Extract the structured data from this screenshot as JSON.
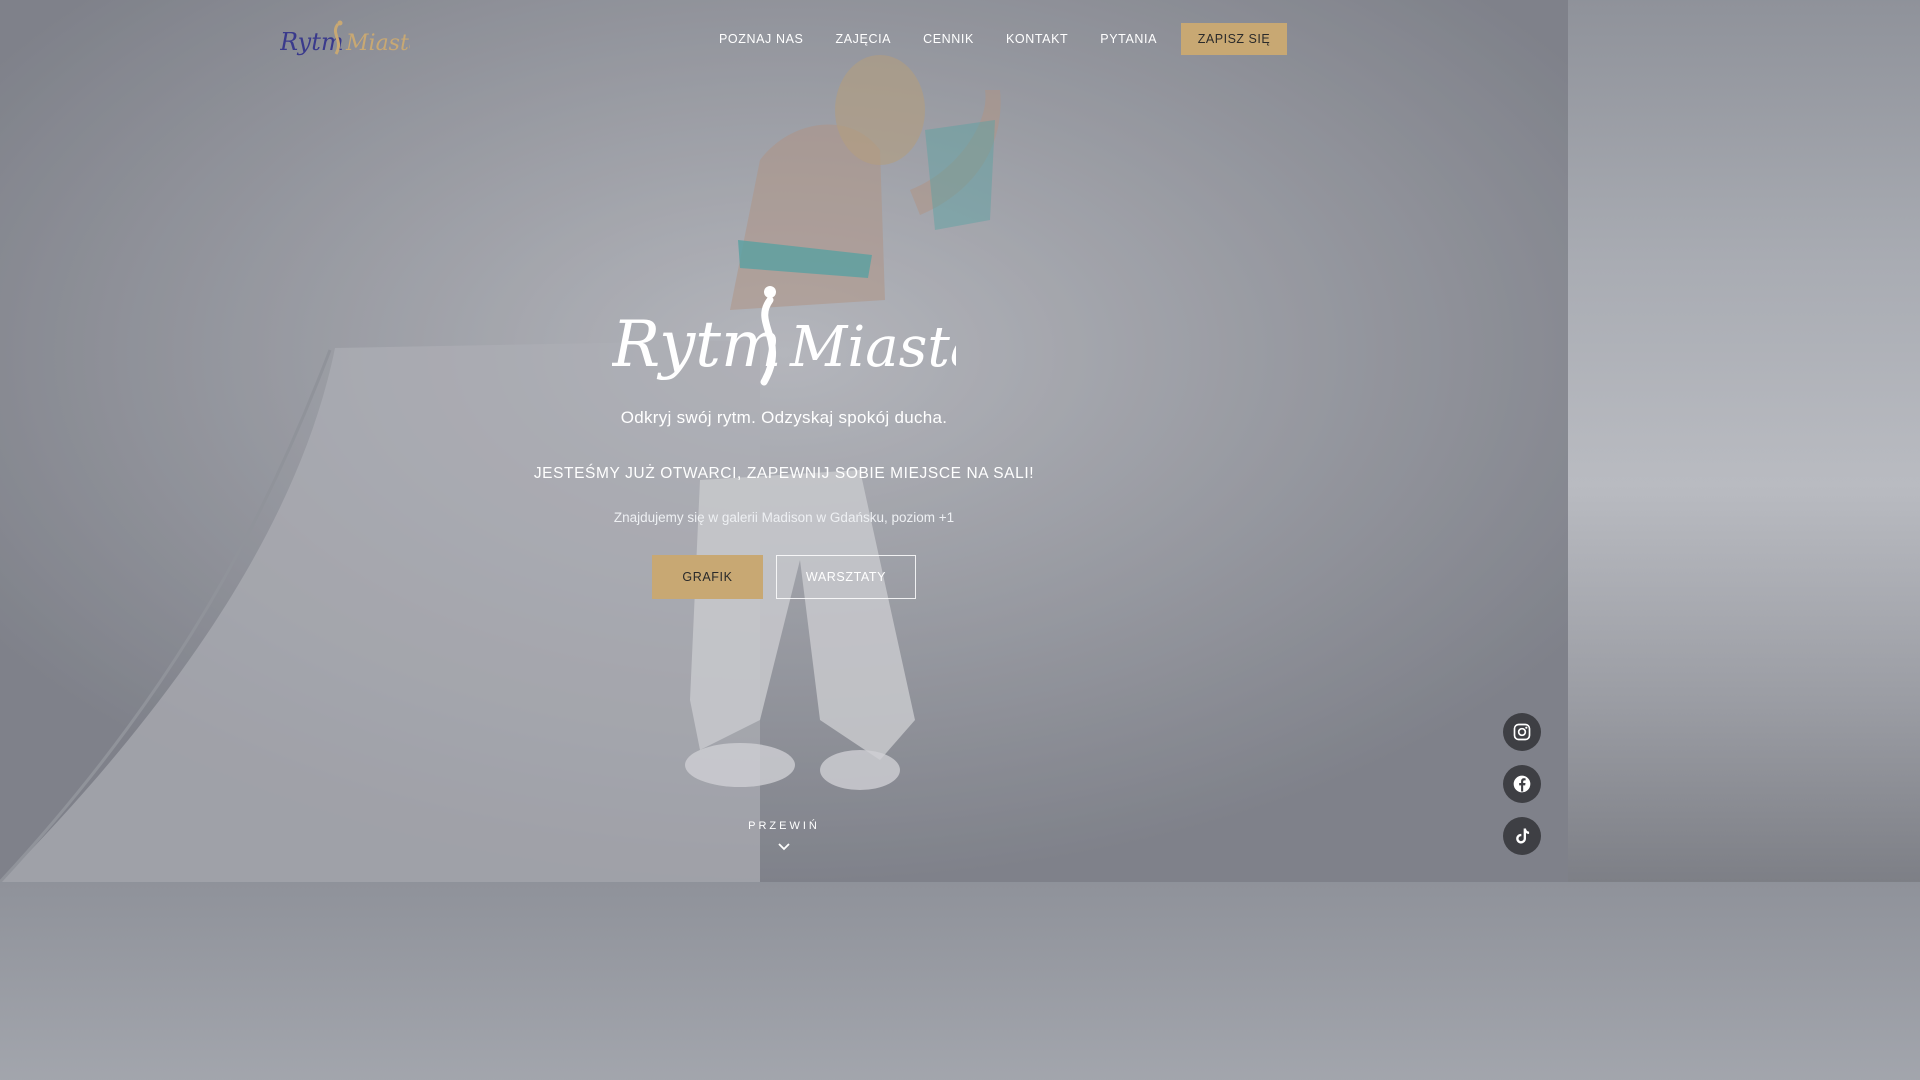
{
  "brand": {
    "logo_text": "RytmMiasta",
    "logo_color_primary": "#3a3a8c",
    "logo_color_accent": "#c8a873"
  },
  "nav": {
    "items": [
      "POZNAJ NAS",
      "ZAJĘCIA",
      "CENNIK",
      "KONTAKT",
      "PYTANIA"
    ],
    "cta": "ZAPISZ SIĘ"
  },
  "hero": {
    "tagline": "Odkryj swój rytm. Odzyskaj spokój ducha.",
    "headline": "JESTEŚMY JUŻ OTWARCI, ZAPEWNIJ SOBIE MIEJSCE NA SALI!",
    "location": "Znajdujemy się w galerii Madison w Gdańsku, poziom +1",
    "primary_button": "GRAFIK",
    "secondary_button": "WARSZTATY",
    "scroll_label": "PRZEWIŃ"
  },
  "social": {
    "icons": [
      "instagram-icon",
      "facebook-icon",
      "tiktok-icon"
    ]
  },
  "colors": {
    "accent": "#c8a873",
    "social_bg": "#3e3f44"
  }
}
